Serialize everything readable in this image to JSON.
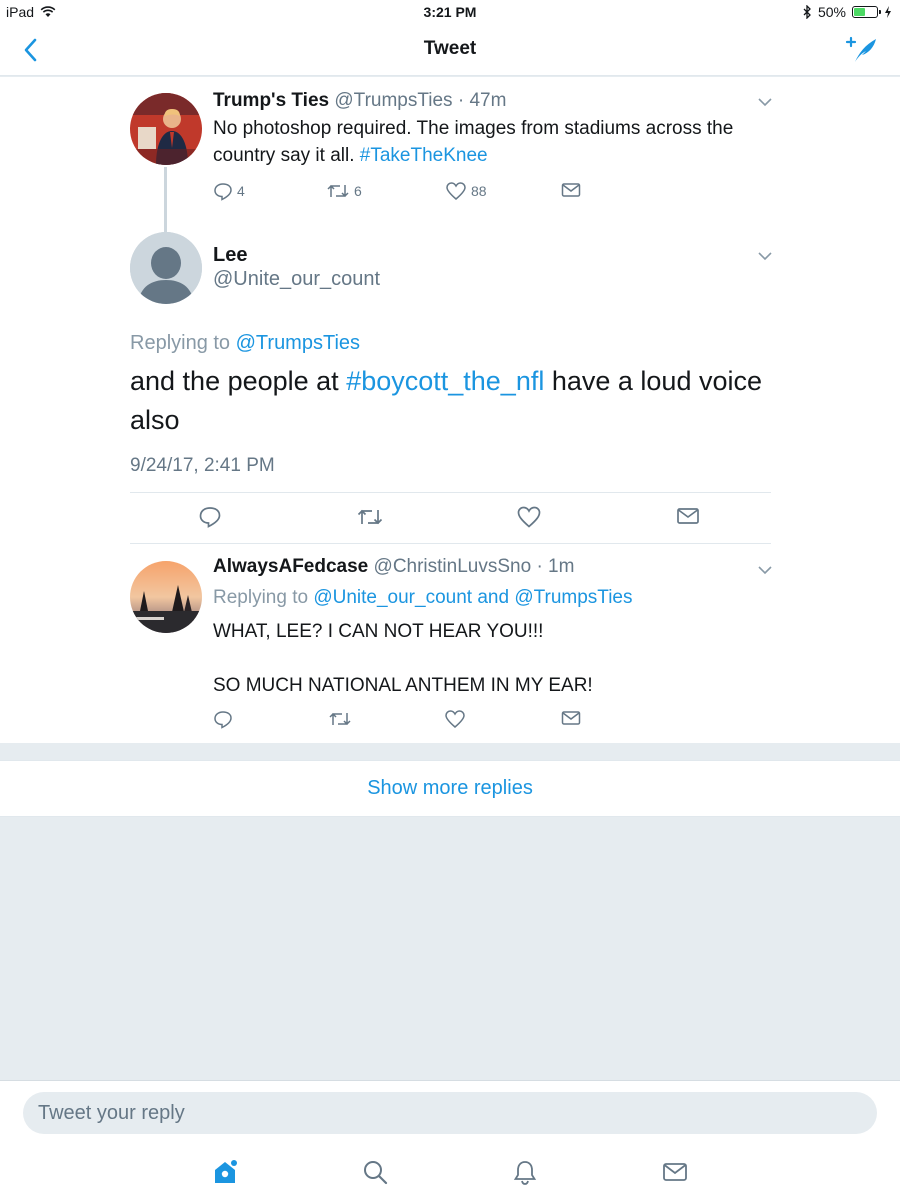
{
  "status_bar": {
    "device": "iPad",
    "time": "3:21 PM",
    "battery": "50%",
    "battery_level": 0.5
  },
  "nav": {
    "title": "Tweet",
    "back_icon": "chevron-left-icon",
    "compose_icon": "compose-tweet-icon"
  },
  "tweets": [
    {
      "name": "Trump's Ties",
      "handle": "@TrumpsTies",
      "time": "· 47m",
      "text_plain": "No photoshop required. The images from stadiums across the country say it all. ",
      "hashtag": "#TakeTheKnee",
      "replies": "4",
      "retweets": "6",
      "likes": "88"
    },
    {
      "name": "Lee",
      "handle": "@Unite_our_count",
      "replying_prefix": "Replying to ",
      "replying_to": "@TrumpsTies",
      "text_before": "and the people at ",
      "hashtag": "#boycott_the_nfl",
      "text_after": " have a loud voice also",
      "date": "9/24/17, 2:41 PM"
    },
    {
      "name": "AlwaysAFedcase",
      "handle": "@ChristinLuvsSno",
      "time": "· 1m",
      "replying_prefix": "Replying to ",
      "replying_to": "@Unite_our_count and @TrumpsTies",
      "line1": "WHAT, LEE? I CAN NOT HEAR YOU!!!",
      "line2": "SO MUCH NATIONAL ANTHEM IN MY EAR!"
    }
  ],
  "show_more": "Show more replies",
  "composer": {
    "placeholder": "Tweet your reply"
  },
  "tabbar": [
    "home-icon",
    "search-icon",
    "notifications-icon",
    "messages-icon"
  ],
  "colors": {
    "accent": "#1b95e0",
    "muted": "#657786",
    "background": "#e6ecf0"
  }
}
